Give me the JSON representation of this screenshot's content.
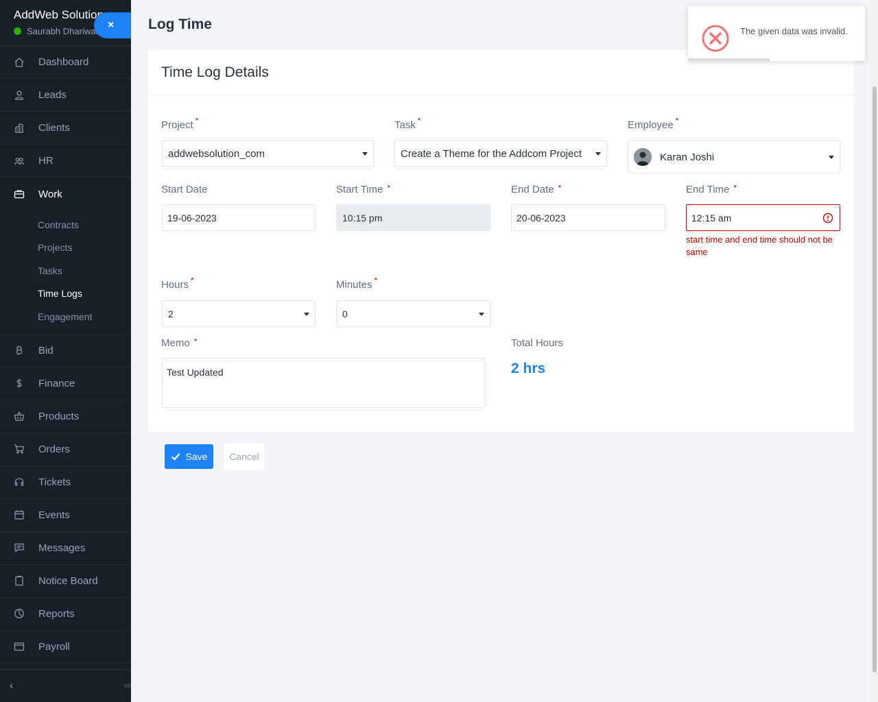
{
  "sidebar": {
    "brand": "AddWeb Solution",
    "user": "Saurabh Dhariwal",
    "close_label": "×",
    "items_top": [
      {
        "label": "Dashboard",
        "icon": "house-icon"
      },
      {
        "label": "Leads",
        "icon": "person-icon"
      },
      {
        "label": "Clients",
        "icon": "building-icon"
      },
      {
        "label": "HR",
        "icon": "people-icon"
      },
      {
        "label": "Work",
        "icon": "briefcase-icon"
      }
    ],
    "work_submenu": [
      "Contracts",
      "Projects",
      "Tasks",
      "Time Logs",
      "Engagement"
    ],
    "items_bottom": [
      {
        "label": "Bid",
        "icon": "bitcoin-icon"
      },
      {
        "label": "Finance",
        "icon": "dollar-icon"
      },
      {
        "label": "Products",
        "icon": "basket-icon"
      },
      {
        "label": "Orders",
        "icon": "cart-icon"
      },
      {
        "label": "Tickets",
        "icon": "headset-icon"
      },
      {
        "label": "Events",
        "icon": "calendar-icon"
      },
      {
        "label": "Messages",
        "icon": "chat-icon"
      },
      {
        "label": "Notice Board",
        "icon": "clipboard-icon"
      },
      {
        "label": "Reports",
        "icon": "pie-chart-icon"
      },
      {
        "label": "Payroll",
        "icon": "wallet-icon"
      }
    ],
    "collapse_label": "‹",
    "version_label": "ve"
  },
  "page": {
    "title": "Log Time",
    "card_title": "Time Log Details"
  },
  "form": {
    "project_label": "Project",
    "project_value": "addwebsolution_com",
    "task_label": "Task",
    "task_value": "Create a Theme for the Addcom Project",
    "employee_label": "Employee",
    "employee_value": "Karan Joshi",
    "start_date_label": "Start Date",
    "start_date_value": "19-06-2023",
    "start_time_label": "Start Time",
    "start_time_value": "10:15 pm",
    "end_date_label": "End Date",
    "end_date_value": "20-06-2023",
    "end_time_label": "End Time",
    "end_time_value": "12:15 am",
    "end_time_error": "start time and end time should not be same",
    "hours_label": "Hours",
    "hours_value": "2",
    "minutes_label": "Minutes",
    "minutes_value": "0",
    "memo_label": "Memo",
    "memo_value": "Test Updated",
    "total_hours_label": "Total Hours",
    "total_hours_value": "2 hrs",
    "required_mark": "*"
  },
  "actions": {
    "save_label": "Save",
    "cancel_label": "Cancel"
  },
  "toast": {
    "message": "The given data was invalid.",
    "progress": 0.46
  },
  "colors": {
    "sidebar_bg": "#171f29",
    "accent": "#1d82f5",
    "error": "#d30000",
    "toast_error_icon": "#f27474"
  }
}
